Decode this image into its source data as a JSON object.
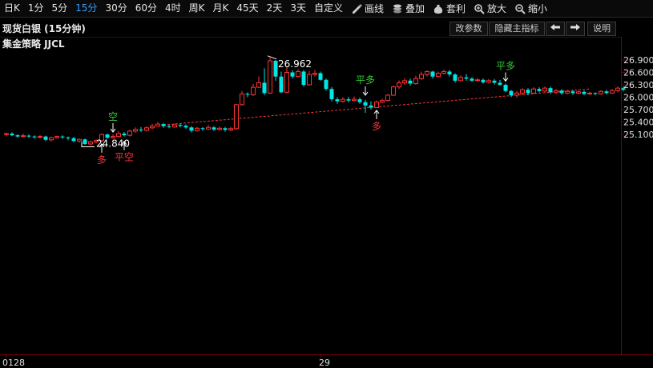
{
  "toolbar": {
    "periods": [
      "日K",
      "1分",
      "5分",
      "15分",
      "30分",
      "60分",
      "4时",
      "周K",
      "月K",
      "45天",
      "2天",
      "3天",
      "自定义"
    ],
    "active_period": "15分",
    "tools": [
      {
        "label": "画线",
        "icon": "pencil-icon"
      },
      {
        "label": "叠加",
        "icon": "stack-icon"
      },
      {
        "label": "套利",
        "icon": "moneybag-icon"
      },
      {
        "label": "放大",
        "icon": "zoom-in-icon"
      },
      {
        "label": "缩小",
        "icon": "zoom-out-icon"
      }
    ]
  },
  "header": {
    "title": "现货白银 (15分钟)",
    "strategy": "集金策略 JJCL",
    "buttons": {
      "modify_params": "改参数",
      "hide_indicator": "隐藏主指标",
      "help": "说明"
    }
  },
  "colors": {
    "up": "#ff3232",
    "down": "#00e5e5",
    "signal_buy": "#ff3232",
    "signal_sell": "#33cc33",
    "trend": "#ff3232",
    "axis": "#7a0000"
  },
  "chart_data": {
    "type": "candlestick",
    "y_ticks": [
      "26.900",
      "26.600",
      "26.300",
      "26.000",
      "25.700",
      "25.400",
      "25.100"
    ],
    "ylim": [
      24.65,
      27.05
    ],
    "x_labels": [
      {
        "index": 0,
        "label": "0128"
      },
      {
        "index": 56,
        "label": "29"
      }
    ],
    "candles": [
      [
        25.1,
        25.12,
        25.14,
        25.05
      ],
      [
        25.12,
        25.08,
        25.15,
        25.06
      ],
      [
        25.08,
        25.05,
        25.1,
        25.02
      ],
      [
        25.05,
        25.07,
        25.12,
        25.03
      ],
      [
        25.07,
        25.05,
        25.1,
        25.02
      ],
      [
        25.05,
        25.03,
        25.08,
        25.0
      ],
      [
        25.03,
        25.05,
        25.09,
        25.0
      ],
      [
        25.05,
        24.97,
        25.07,
        24.94
      ],
      [
        24.97,
        25.02,
        25.05,
        24.93
      ],
      [
        25.02,
        25.05,
        25.07,
        25.0
      ],
      [
        25.05,
        25.03,
        25.08,
        24.99
      ],
      [
        25.03,
        25.01,
        25.05,
        24.96
      ],
      [
        25.01,
        24.94,
        25.04,
        24.92
      ],
      [
        24.94,
        24.98,
        25.0,
        24.9
      ],
      [
        24.98,
        24.87,
        25.0,
        24.85
      ],
      [
        24.87,
        24.92,
        24.95,
        24.84
      ],
      [
        24.92,
        24.95,
        24.98,
        24.88
      ],
      [
        24.95,
        25.1,
        25.12,
        24.93
      ],
      [
        25.1,
        25.02,
        25.12,
        24.99
      ],
      [
        25.02,
        25.05,
        25.1,
        25.0
      ],
      [
        25.05,
        25.12,
        25.18,
        25.02
      ],
      [
        25.12,
        25.08,
        25.16,
        25.05
      ],
      [
        25.08,
        25.18,
        25.22,
        25.05
      ],
      [
        25.18,
        25.22,
        25.27,
        25.14
      ],
      [
        25.22,
        25.2,
        25.28,
        25.16
      ],
      [
        25.2,
        25.26,
        25.3,
        25.17
      ],
      [
        25.26,
        25.3,
        25.36,
        25.23
      ],
      [
        25.3,
        25.35,
        25.4,
        25.28
      ],
      [
        25.35,
        25.3,
        25.38,
        25.26
      ],
      [
        25.3,
        25.28,
        25.33,
        25.25
      ],
      [
        25.28,
        25.33,
        25.36,
        25.26
      ],
      [
        25.33,
        25.31,
        25.36,
        25.27
      ],
      [
        25.31,
        25.27,
        25.34,
        25.24
      ],
      [
        25.27,
        25.19,
        25.3,
        25.15
      ],
      [
        25.19,
        25.25,
        25.28,
        25.17
      ],
      [
        25.25,
        25.23,
        25.28,
        25.19
      ],
      [
        25.23,
        25.27,
        25.33,
        25.21
      ],
      [
        25.27,
        25.22,
        25.3,
        25.18
      ],
      [
        25.22,
        25.25,
        25.29,
        25.19
      ],
      [
        25.25,
        25.21,
        25.28,
        25.17
      ],
      [
        25.21,
        25.24,
        25.28,
        25.18
      ],
      [
        25.24,
        25.82,
        25.84,
        25.21
      ],
      [
        25.82,
        26.08,
        26.15,
        25.8
      ],
      [
        26.08,
        26.06,
        26.12,
        26.0
      ],
      [
        26.06,
        26.24,
        26.32,
        26.03
      ],
      [
        26.24,
        26.35,
        26.5,
        26.22
      ],
      [
        26.35,
        26.1,
        26.7,
        26.05
      ],
      [
        26.1,
        26.88,
        26.96,
        26.08
      ],
      [
        26.88,
        26.5,
        26.9,
        26.4
      ],
      [
        26.5,
        26.12,
        26.62,
        26.1
      ],
      [
        26.12,
        26.6,
        26.75,
        26.1
      ],
      [
        26.6,
        26.5,
        26.65,
        26.45
      ],
      [
        26.5,
        26.62,
        26.68,
        26.48
      ],
      [
        26.62,
        26.3,
        26.66,
        26.26
      ],
      [
        26.3,
        26.55,
        26.64,
        26.28
      ],
      [
        26.55,
        26.58,
        26.66,
        26.5
      ],
      [
        26.58,
        26.42,
        26.62,
        26.4
      ],
      [
        26.42,
        26.2,
        26.45,
        26.16
      ],
      [
        26.2,
        25.95,
        26.25,
        25.9
      ],
      [
        25.95,
        25.9,
        26.0,
        25.84
      ],
      [
        25.9,
        25.95,
        26.0,
        25.87
      ],
      [
        25.95,
        25.92,
        26.01,
        25.88
      ],
      [
        25.92,
        25.95,
        26.02,
        25.89
      ],
      [
        25.95,
        25.88,
        25.99,
        25.84
      ],
      [
        25.88,
        25.8,
        25.94,
        25.62
      ],
      [
        25.8,
        25.75,
        25.9,
        25.7
      ],
      [
        25.75,
        25.88,
        25.92,
        25.74
      ],
      [
        25.88,
        25.92,
        25.96,
        25.86
      ],
      [
        25.92,
        26.05,
        26.08,
        25.9
      ],
      [
        26.05,
        26.25,
        26.28,
        26.03
      ],
      [
        26.25,
        26.35,
        26.41,
        26.2
      ],
      [
        26.35,
        26.4,
        26.46,
        26.3
      ],
      [
        26.4,
        26.33,
        26.45,
        26.28
      ],
      [
        26.33,
        26.45,
        26.52,
        26.3
      ],
      [
        26.45,
        26.55,
        26.62,
        26.42
      ],
      [
        26.55,
        26.62,
        26.65,
        26.5
      ],
      [
        26.62,
        26.5,
        26.64,
        26.45
      ],
      [
        26.5,
        26.58,
        26.62,
        26.48
      ],
      [
        26.58,
        26.62,
        26.67,
        26.55
      ],
      [
        26.62,
        26.55,
        26.66,
        26.5
      ],
      [
        26.55,
        26.4,
        26.58,
        26.35
      ],
      [
        26.4,
        26.48,
        26.53,
        26.38
      ],
      [
        26.48,
        26.45,
        26.56,
        26.4
      ],
      [
        26.45,
        26.4,
        26.48,
        26.37
      ],
      [
        26.4,
        26.42,
        26.47,
        26.38
      ],
      [
        26.42,
        26.36,
        26.45,
        26.33
      ],
      [
        26.36,
        26.4,
        26.44,
        26.33
      ],
      [
        26.4,
        26.35,
        26.44,
        26.31
      ],
      [
        26.35,
        26.3,
        26.42,
        26.28
      ],
      [
        26.3,
        26.15,
        26.33,
        26.12
      ],
      [
        26.15,
        26.05,
        26.18,
        26.0
      ],
      [
        26.05,
        26.1,
        26.15,
        25.99
      ],
      [
        26.1,
        26.18,
        26.22,
        26.06
      ],
      [
        26.18,
        26.1,
        26.22,
        26.05
      ],
      [
        26.1,
        26.2,
        26.24,
        26.08
      ],
      [
        26.2,
        26.15,
        26.24,
        26.12
      ],
      [
        26.15,
        26.22,
        26.26,
        26.12
      ],
      [
        26.22,
        26.12,
        26.26,
        26.08
      ],
      [
        26.12,
        26.16,
        26.2,
        26.08
      ],
      [
        26.16,
        26.1,
        26.2,
        26.06
      ],
      [
        26.1,
        26.14,
        26.18,
        26.07
      ],
      [
        26.14,
        26.1,
        26.18,
        26.06
      ],
      [
        26.1,
        26.13,
        26.16,
        26.07
      ],
      [
        26.13,
        26.08,
        26.16,
        26.05
      ],
      [
        26.08,
        26.1,
        26.13,
        26.05
      ],
      [
        26.1,
        26.08,
        26.12,
        26.05
      ],
      [
        26.08,
        26.14,
        26.17,
        26.06
      ],
      [
        26.14,
        26.1,
        26.18,
        26.07
      ],
      [
        26.1,
        26.16,
        26.2,
        26.08
      ],
      [
        26.16,
        26.22,
        26.26,
        26.12
      ],
      [
        26.22,
        26.18,
        26.26,
        26.14
      ]
    ],
    "trend_line": [
      {
        "index": 28,
        "price": 25.33
      },
      {
        "index": 104,
        "price": 26.2
      }
    ],
    "annotations": [
      {
        "text": "26.962",
        "index": 47,
        "price": 26.962,
        "type": "high"
      },
      {
        "text": "24.840",
        "index": 15,
        "price": 24.84,
        "type": "low"
      }
    ],
    "signals": [
      {
        "text": "空",
        "index": 19,
        "price": 25.1,
        "color": "sell",
        "pos": "above"
      },
      {
        "text": "平多",
        "index": 64,
        "price": 25.99,
        "color": "sell",
        "pos": "above"
      },
      {
        "text": "多",
        "index": 66,
        "price": 25.74,
        "color": "buy",
        "pos": "below"
      },
      {
        "text": "平多",
        "index": 89,
        "price": 26.33,
        "color": "sell",
        "pos": "above"
      },
      {
        "text": "多",
        "index": 17,
        "price": 24.93,
        "color": "buy",
        "pos": "below"
      },
      {
        "text": "平空",
        "index": 21,
        "price": 24.99,
        "color": "buy",
        "pos": "below"
      }
    ]
  }
}
